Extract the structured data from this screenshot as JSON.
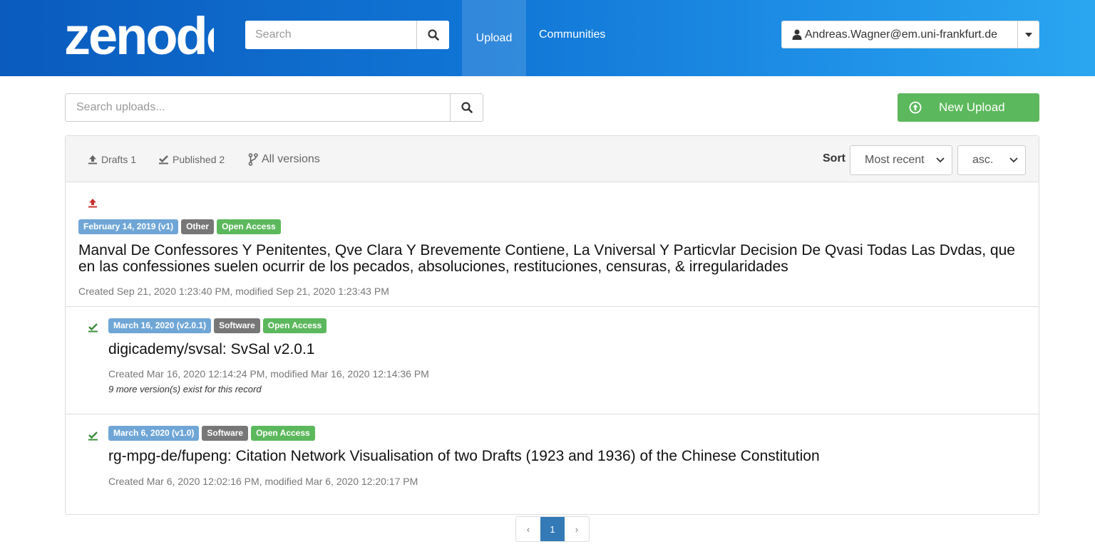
{
  "header": {
    "logo_text": "zenodo",
    "search_placeholder": "Search",
    "nav": {
      "upload": "Upload",
      "communities": "Communities"
    },
    "user": "Andreas.Wagner@em.uni-frankfurt.de"
  },
  "toolbar": {
    "search_placeholder": "Search uploads...",
    "new_upload_label": "New Upload"
  },
  "filters": {
    "drafts": "Drafts 1",
    "published": "Published 2",
    "all_versions": "All versions",
    "sort_label": "Sort",
    "sort_value": "Most recent",
    "order_value": "asc."
  },
  "uploads": [
    {
      "status": "draft",
      "date_badge": "February 14, 2019 (v1)",
      "type_badge": "Other",
      "access_badge": "Open Access",
      "title": "Manval De Confessores Y Penitentes, Qve Clara Y Brevemente Contiene, La Vniversal Y Particvlar Decision De Qvasi Todas Las Dvdas, que en las confessiones suelen ocurrir de los pecados, absoluciones, restituciones, censuras, & irregularidades",
      "meta": "Created Sep 21, 2020 1:23:40 PM, modified Sep 21, 2020 1:23:43 PM",
      "versions_note": ""
    },
    {
      "status": "published",
      "date_badge": "March 16, 2020 (v2.0.1)",
      "type_badge": "Software",
      "access_badge": "Open Access",
      "title": "digicademy/svsal: SvSal v2.0.1",
      "meta": "Created Mar 16, 2020 12:14:24 PM, modified Mar 16, 2020 12:14:36 PM",
      "versions_note": "9 more version(s) exist for this record"
    },
    {
      "status": "published",
      "date_badge": "March 6, 2020 (v1.0)",
      "type_badge": "Software",
      "access_badge": "Open Access",
      "title": "rg-mpg-de/fupeng: Citation Network Visualisation of two Drafts (1923 and 1936) of the Chinese Constitution",
      "meta": "Created Mar 6, 2020 12:02:16 PM, modified Mar 6, 2020 12:20:17 PM",
      "versions_note": ""
    }
  ],
  "pagination": {
    "prev": "‹",
    "current": "1",
    "next": "›"
  },
  "colors": {
    "header_start": "#0a5bbd",
    "header_end": "#2aa6f0",
    "success": "#5cb85c",
    "primary": "#337ab7",
    "draft_icon": "#c9302c",
    "published_icon": "#3c8d3c"
  }
}
